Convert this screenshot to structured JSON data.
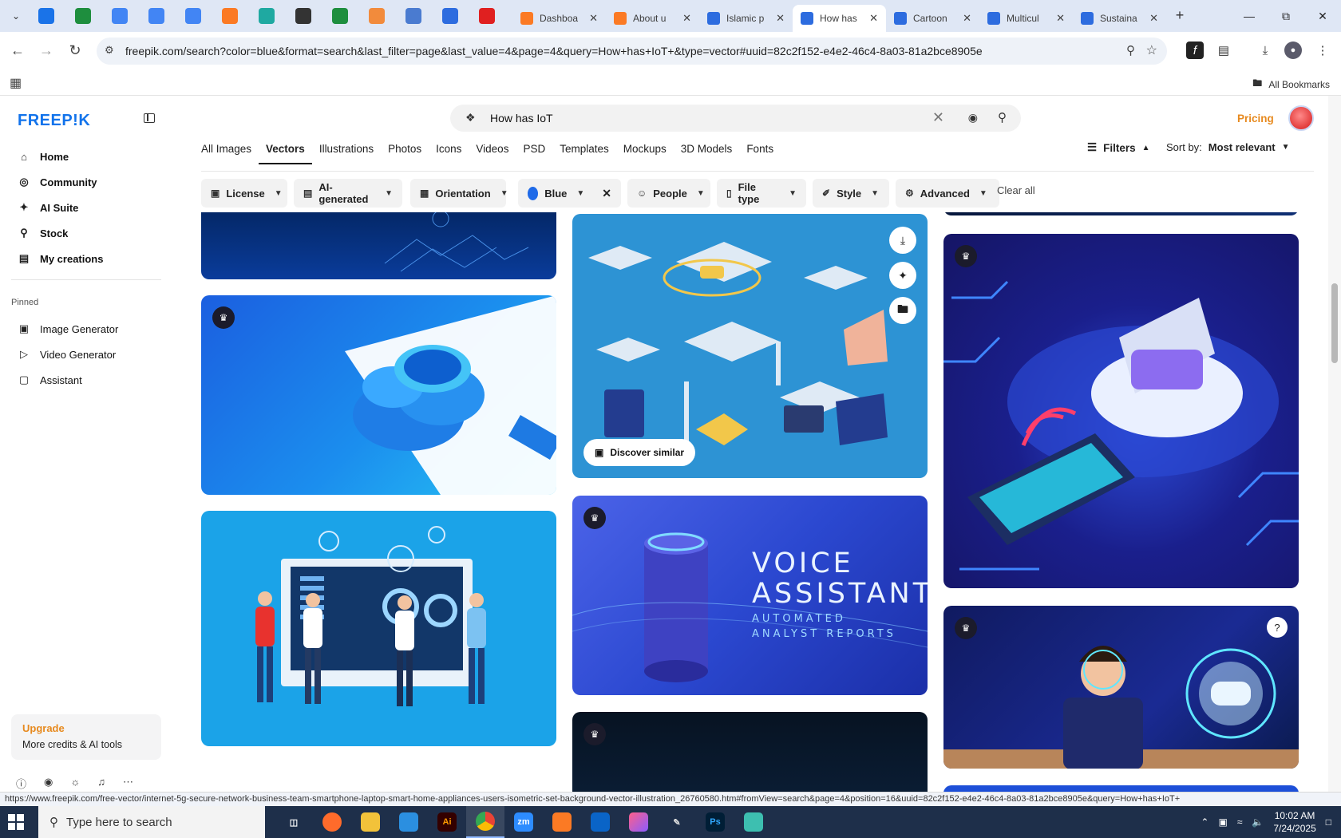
{
  "browser": {
    "pinned_tabs": [
      {
        "icon": "vpn-icon",
        "color": "#1a73e8"
      },
      {
        "icon": "sheets-icon",
        "color": "#1e8e3e"
      },
      {
        "icon": "docs-icon",
        "color": "#4285f4"
      },
      {
        "icon": "docs-icon",
        "color": "#4285f4"
      },
      {
        "icon": "docs-icon",
        "color": "#4285f4"
      },
      {
        "icon": "xampp-icon",
        "color": "#fb7a24"
      },
      {
        "icon": "app-icon",
        "color": "#1fa9a1"
      },
      {
        "icon": "chatgpt-icon",
        "color": "#333333"
      },
      {
        "icon": "sheets-icon",
        "color": "#1e8e3e"
      },
      {
        "icon": "hand-icon",
        "color": "#f28b3c"
      },
      {
        "icon": "grid-app-icon",
        "color": "#4a7bd0"
      },
      {
        "icon": "forms-icon",
        "color": "#2d6cdf"
      },
      {
        "icon": "youtube-icon",
        "color": "#e02020"
      }
    ],
    "tabs": [
      {
        "title": "Dashboa",
        "icon_color": "#fb7a24",
        "active": false
      },
      {
        "title": "About u",
        "icon_color": "#fb7a24",
        "active": false
      },
      {
        "title": "Islamic p",
        "icon_color": "#2d6cdf",
        "active": false
      },
      {
        "title": "How has",
        "icon_color": "#2d6cdf",
        "active": true
      },
      {
        "title": "Cartoon",
        "icon_color": "#2d6cdf",
        "active": false
      },
      {
        "title": "Multicul",
        "icon_color": "#2d6cdf",
        "active": false
      },
      {
        "title": "Sustaina",
        "icon_color": "#2d6cdf",
        "active": false
      }
    ],
    "url": "freepik.com/search?color=blue&format=search&last_filter=page&last_value=4&page=4&query=How+has+IoT+&type=vector#uuid=82c2f152-e4e2-46c4-8a03-81a2bce8905e",
    "all_bookmarks": "All Bookmarks",
    "status_url": "https://www.freepik.com/free-vector/internet-5g-secure-network-business-team-smartphone-laptop-smart-home-appliances-users-isometric-set-background-vector-illustration_26760580.htm#fromView=search&page=4&position=16&uuid=82c2f152-e4e2-46c4-8a03-81a2bce8905e&query=How+has+IoT+"
  },
  "site": {
    "logo": "FREEP!K",
    "nav": [
      {
        "label": "Home",
        "icon": "home-icon"
      },
      {
        "label": "Community",
        "icon": "globe-icon"
      },
      {
        "label": "AI Suite",
        "icon": "sparkle-icon"
      },
      {
        "label": "Stock",
        "icon": "search-icon"
      },
      {
        "label": "My creations",
        "icon": "folder-icon"
      }
    ],
    "pinned_label": "Pinned",
    "pinned": [
      {
        "label": "Image Generator",
        "icon": "image-icon"
      },
      {
        "label": "Video Generator",
        "icon": "video-icon"
      },
      {
        "label": "Assistant",
        "icon": "chat-icon"
      }
    ],
    "upgrade": {
      "title": "Upgrade",
      "subtitle": "More credits & AI tools"
    },
    "search_query": "How has IoT",
    "pricing": "Pricing",
    "type_tabs": [
      "All Images",
      "Vectors",
      "Illustrations",
      "Photos",
      "Icons",
      "Videos",
      "PSD",
      "Templates",
      "Mockups",
      "3D Models",
      "Fonts"
    ],
    "active_type": "Vectors",
    "filters_label": "Filters",
    "sort_label": "Sort by:",
    "sort_value": "Most relevant",
    "chips": [
      {
        "label": "License",
        "icon": "license-icon"
      },
      {
        "label": "AI-generated",
        "icon": "ai-icon"
      },
      {
        "label": "Orientation",
        "icon": "orientation-icon"
      },
      {
        "label": "Blue",
        "icon": "color-dot"
      },
      {
        "label": "People",
        "icon": "people-icon"
      },
      {
        "label": "File type",
        "icon": "file-icon"
      },
      {
        "label": "Style",
        "icon": "style-icon"
      },
      {
        "label": "Advanced",
        "icon": "advanced-icon"
      }
    ],
    "clear_all": "Clear all",
    "discover_similar": "Discover similar",
    "voice_card": {
      "title_line1": "VOICE",
      "title_line2": "ASSISTANT",
      "sub_line1": "AUTOMATED",
      "sub_line2": "ANALYST REPORTS"
    }
  },
  "taskbar": {
    "search_placeholder": "Type here to search",
    "time": "10:02 AM",
    "date": "7/24/2025"
  }
}
